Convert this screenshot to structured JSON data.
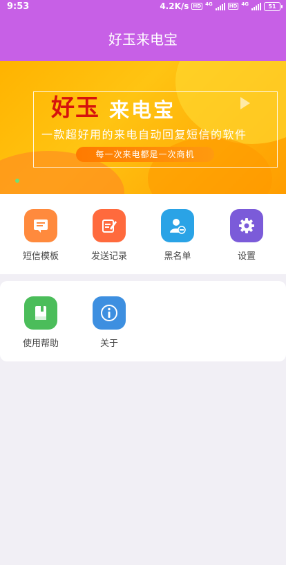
{
  "status_bar": {
    "time": "9:53",
    "speed": "4.2K/s",
    "hd_badge": "HD",
    "network": "4G",
    "battery": "51"
  },
  "app_bar": {
    "title": "好玉来电宝"
  },
  "banner": {
    "brand_part1": "好玉",
    "brand_part2": "来电宝",
    "slogan": "一款超好用的来电自动回复短信的软件",
    "tagline": "每一次来电都是一次商机"
  },
  "menu_primary": [
    {
      "label": "短信模板",
      "icon": "message-template-icon",
      "color": "#ff8a3d"
    },
    {
      "label": "发送记录",
      "icon": "send-record-icon",
      "color": "#ff6a3d"
    },
    {
      "label": "黑名单",
      "icon": "blacklist-icon",
      "color": "#2aa3e6"
    },
    {
      "label": "设置",
      "icon": "gear-icon",
      "color": "#7b5bd9"
    }
  ],
  "menu_secondary": [
    {
      "label": "使用帮助",
      "icon": "help-book-icon",
      "color": "#4bbd5a"
    },
    {
      "label": "关于",
      "icon": "info-icon",
      "color": "#3d8fe0"
    }
  ]
}
